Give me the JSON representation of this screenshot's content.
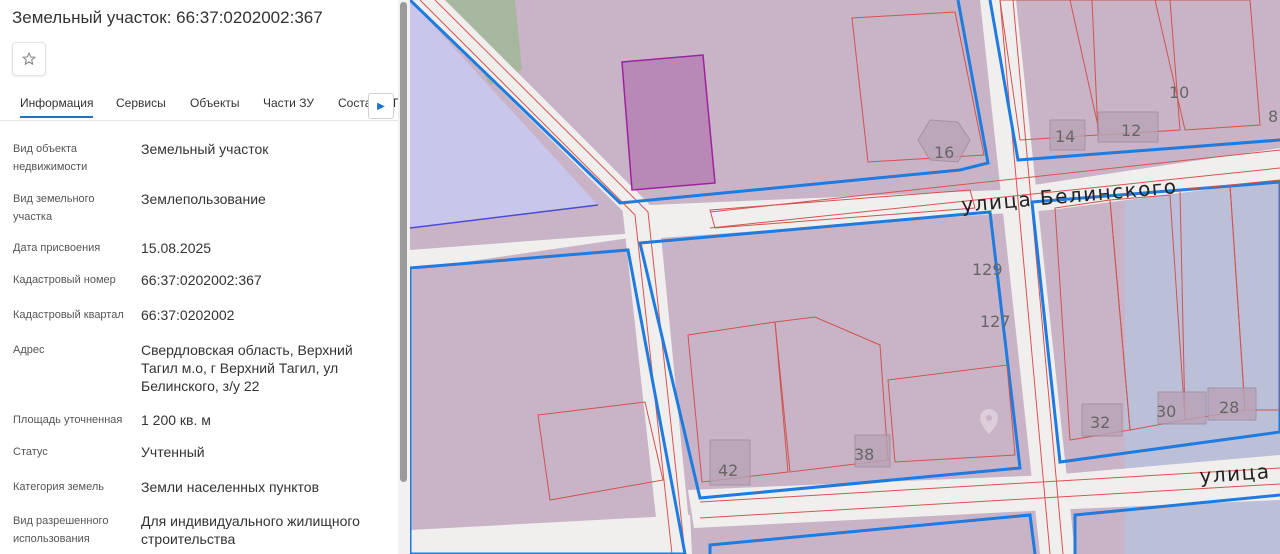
{
  "panel": {
    "title": "Земельный участок: 66:37:0202002:367",
    "tabs": [
      "Информация",
      "Сервисы",
      "Объекты",
      "Части ЗУ",
      "Соста",
      "П"
    ],
    "active_tab": "Информация",
    "fields": [
      {
        "label": "Вид объекта недвижимости",
        "value": "Земельный участок"
      },
      {
        "label": "Вид земельного участка",
        "value": "Землепользование"
      },
      {
        "label": "Дата присвоения",
        "value": "15.08.2025"
      },
      {
        "label": "Кадастровый номер",
        "value": "66:37:0202002:367"
      },
      {
        "label": "Кадастровый квартал",
        "value": "66:37:0202002"
      },
      {
        "label": "Адрес",
        "value": "Свердловская область, Верхний Тагил м.о, г Верхний Тагил, ул Белинского, з/у 22"
      },
      {
        "label": "Площадь уточненная",
        "value": "1 200 кв. м"
      },
      {
        "label": "Статус",
        "value": "Учтенный"
      },
      {
        "label": "Категория земель",
        "value": "Земли населенных пунктов"
      },
      {
        "label": "Вид разрешенного использования",
        "value": "Для индивидуального жилищного строительства"
      }
    ],
    "icons": {
      "favorite": "star-outline-icon",
      "tabs_next": "chevron-right-icon"
    }
  },
  "map": {
    "street_labels": [
      "улица Белинского",
      "улица"
    ],
    "house_numbers": [
      "16",
      "14",
      "12",
      "10",
      "8",
      "129",
      "127",
      "42",
      "38",
      "32",
      "30",
      "28"
    ],
    "colors": {
      "background": "#c9b4c7",
      "road": "#f1efee",
      "block_border": "#1e7be0",
      "parcel_border": "#d9534f",
      "selected_parcel": "#b889b6",
      "water": "#c9c6ec",
      "zone": "#b7c3e0",
      "greenery": "#a7b79f"
    }
  }
}
